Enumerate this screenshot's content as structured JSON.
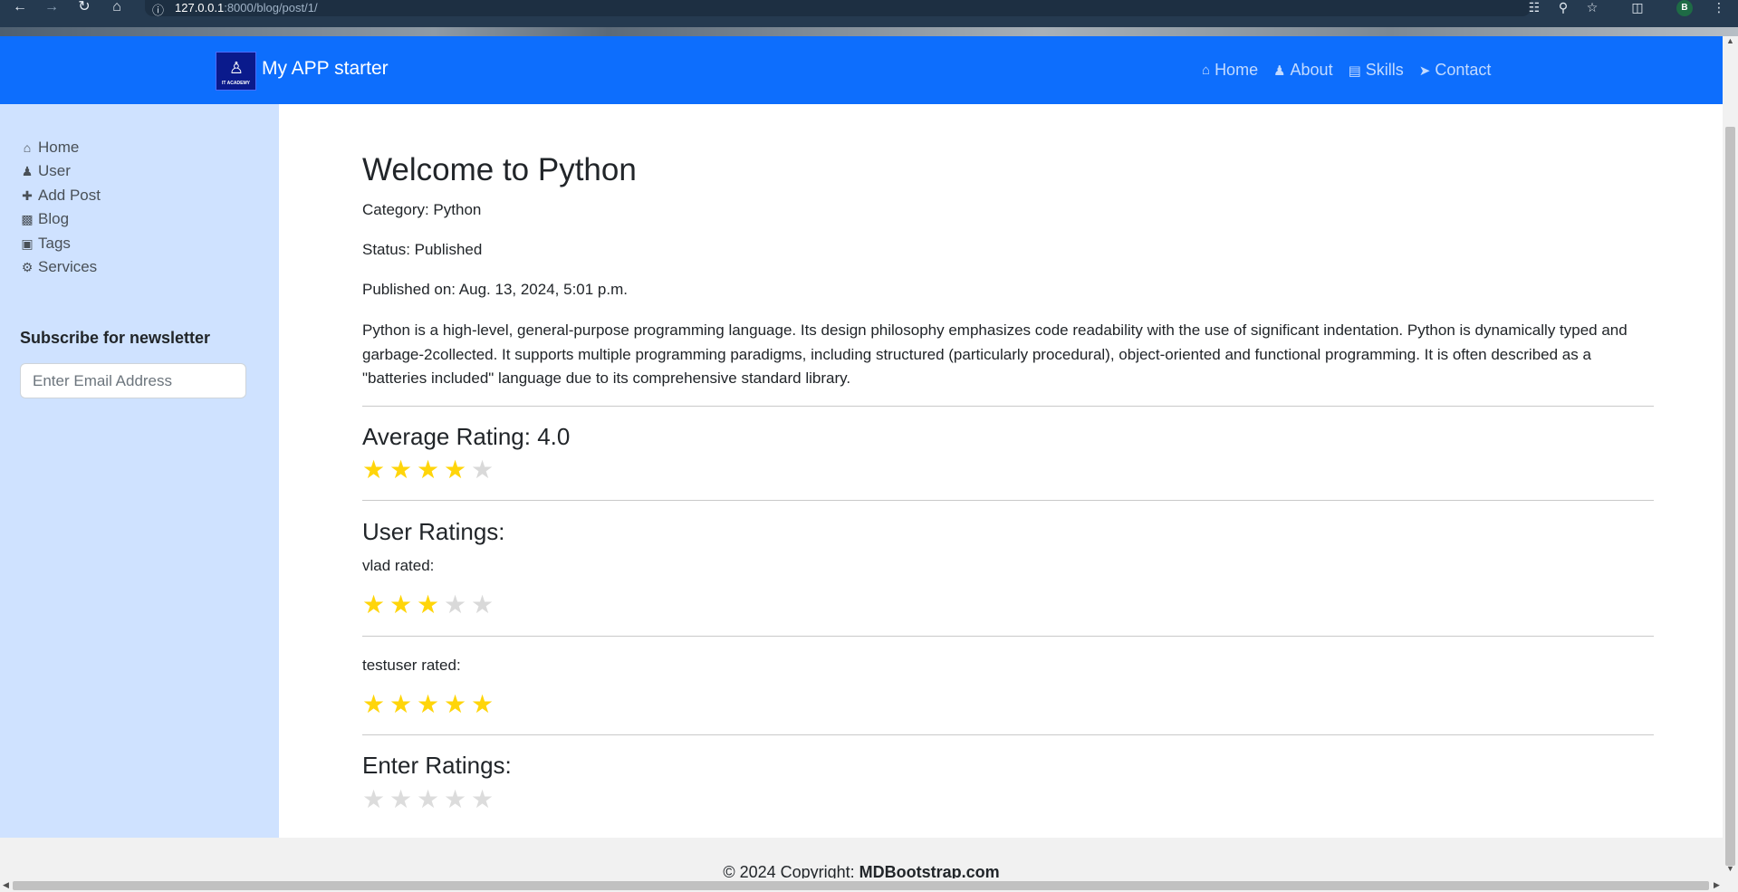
{
  "browser": {
    "url_host": "127.0.0.1",
    "url_rest": ":8000/blog/post/1/",
    "profile_initial": "B"
  },
  "navbar": {
    "brand": "My APP starter",
    "logo_text": "IT ACADEMY",
    "links": [
      {
        "label": "Home",
        "icon": "home-icon"
      },
      {
        "label": "About",
        "icon": "user-icon"
      },
      {
        "label": "Skills",
        "icon": "book-icon"
      },
      {
        "label": "Contact",
        "icon": "paper-plane-icon"
      }
    ]
  },
  "sidebar": {
    "items": [
      {
        "label": "Home",
        "icon": "home-icon"
      },
      {
        "label": "User",
        "icon": "user-icon"
      },
      {
        "label": "Add Post",
        "icon": "plus-icon"
      },
      {
        "label": "Blog",
        "icon": "sticky-note-icon"
      },
      {
        "label": "Tags",
        "icon": "briefcase-icon"
      },
      {
        "label": "Services",
        "icon": "gears-icon"
      }
    ],
    "newsletter_title": "Subscribe for newsletter",
    "email_placeholder": "Enter Email Address"
  },
  "post": {
    "title": "Welcome to Python",
    "category": "Category: Python",
    "status": "Status: Published",
    "published": "Published on: Aug. 13, 2024, 5:01 p.m.",
    "body": "Python is a high-level, general-purpose programming language. Its design philosophy emphasizes code readability with the use of significant indentation. Python is dynamically typed and garbage-2collected. It supports multiple programming paradigms, including structured (particularly procedural), object-oriented and functional programming. It is often described as a \"batteries included\" language due to its comprehensive standard library."
  },
  "ratings": {
    "average_heading": "Average Rating: 4.0",
    "average_value": 4,
    "max": 5,
    "user_heading": "User Ratings:",
    "users": [
      {
        "label": "vlad rated:",
        "value": 3
      },
      {
        "label": "testuser rated:",
        "value": 5
      }
    ],
    "enter_heading": "Enter Ratings:"
  },
  "footer": {
    "copyright": "© 2024 Copyright: ",
    "brand": "MDBootstrap.com"
  },
  "colors": {
    "navbar": "#0d6efd",
    "sidebar": "#cfe2ff",
    "star_on": "#ffd50a",
    "star_off": "#d9d9d9"
  }
}
